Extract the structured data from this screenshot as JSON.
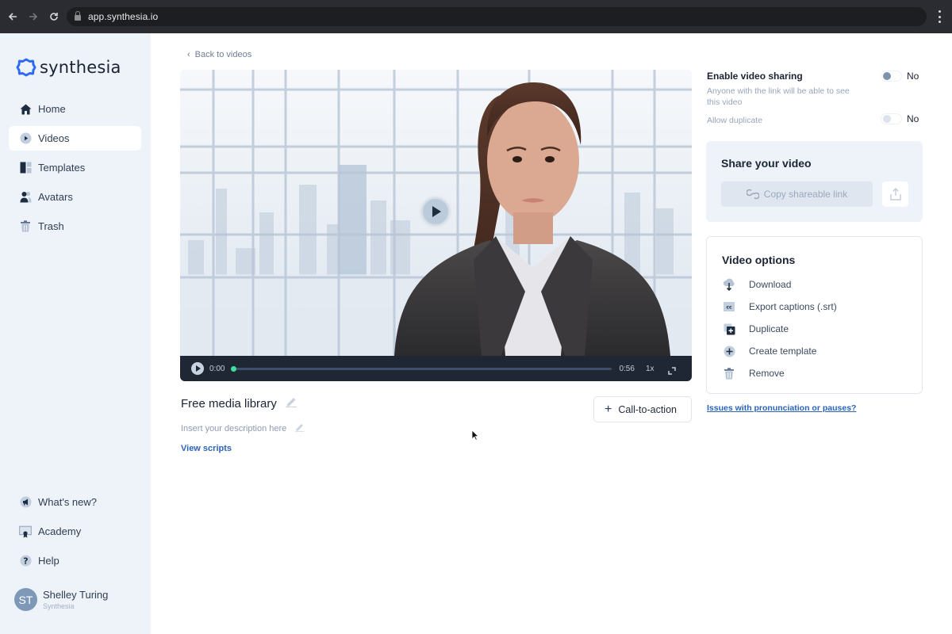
{
  "browser": {
    "url": "app.synthesia.io",
    "back_icon": "arrow-left-icon",
    "forward_icon": "arrow-right-icon",
    "reload_icon": "reload-icon",
    "menu_icon": "kebab-menu-icon"
  },
  "brand": {
    "name": "synthesia",
    "accent": "#2f6bf2"
  },
  "sidebar": {
    "items": [
      {
        "label": "Home",
        "icon": "home-icon",
        "active": false
      },
      {
        "label": "Videos",
        "icon": "play-circle-icon",
        "active": true
      },
      {
        "label": "Templates",
        "icon": "templates-icon",
        "active": false
      },
      {
        "label": "Avatars",
        "icon": "avatars-icon",
        "active": false
      },
      {
        "label": "Trash",
        "icon": "trash-icon",
        "active": false
      }
    ],
    "bottom_items": [
      {
        "label": "What's new?",
        "icon": "megaphone-icon"
      },
      {
        "label": "Academy",
        "icon": "certificate-icon"
      },
      {
        "label": "Help",
        "icon": "help-icon"
      }
    ],
    "user": {
      "initials": "ST",
      "name": "Shelley Turing",
      "org": "Synthesia"
    }
  },
  "main": {
    "back_label": "Back to videos",
    "player": {
      "current_time": "0:00",
      "duration": "0:56",
      "speed": "1x",
      "progress": 0
    },
    "video_title": "Free media library",
    "description_placeholder": "Insert your description here",
    "view_scripts_label": "View scripts",
    "cta_label": "Call-to-action"
  },
  "right_panel": {
    "sharing": {
      "title": "Enable video sharing",
      "subtitle": "Anyone with the link will be able to see this video",
      "value": "No",
      "enabled": false
    },
    "duplicate": {
      "label": "Allow duplicate",
      "value": "No",
      "enabled": false
    },
    "share_card": {
      "title": "Share your video",
      "copy_label": "Copy shareable link"
    },
    "options": {
      "title": "Video options",
      "items": [
        {
          "label": "Download",
          "icon": "cloud-download-icon"
        },
        {
          "label": "Export captions (.srt)",
          "icon": "closed-captions-icon"
        },
        {
          "label": "Duplicate",
          "icon": "duplicate-icon"
        },
        {
          "label": "Create template",
          "icon": "plus-circle-icon"
        },
        {
          "label": "Remove",
          "icon": "trash-icon"
        }
      ]
    },
    "issues_link": "Issues with pronunciation or pauses?"
  }
}
